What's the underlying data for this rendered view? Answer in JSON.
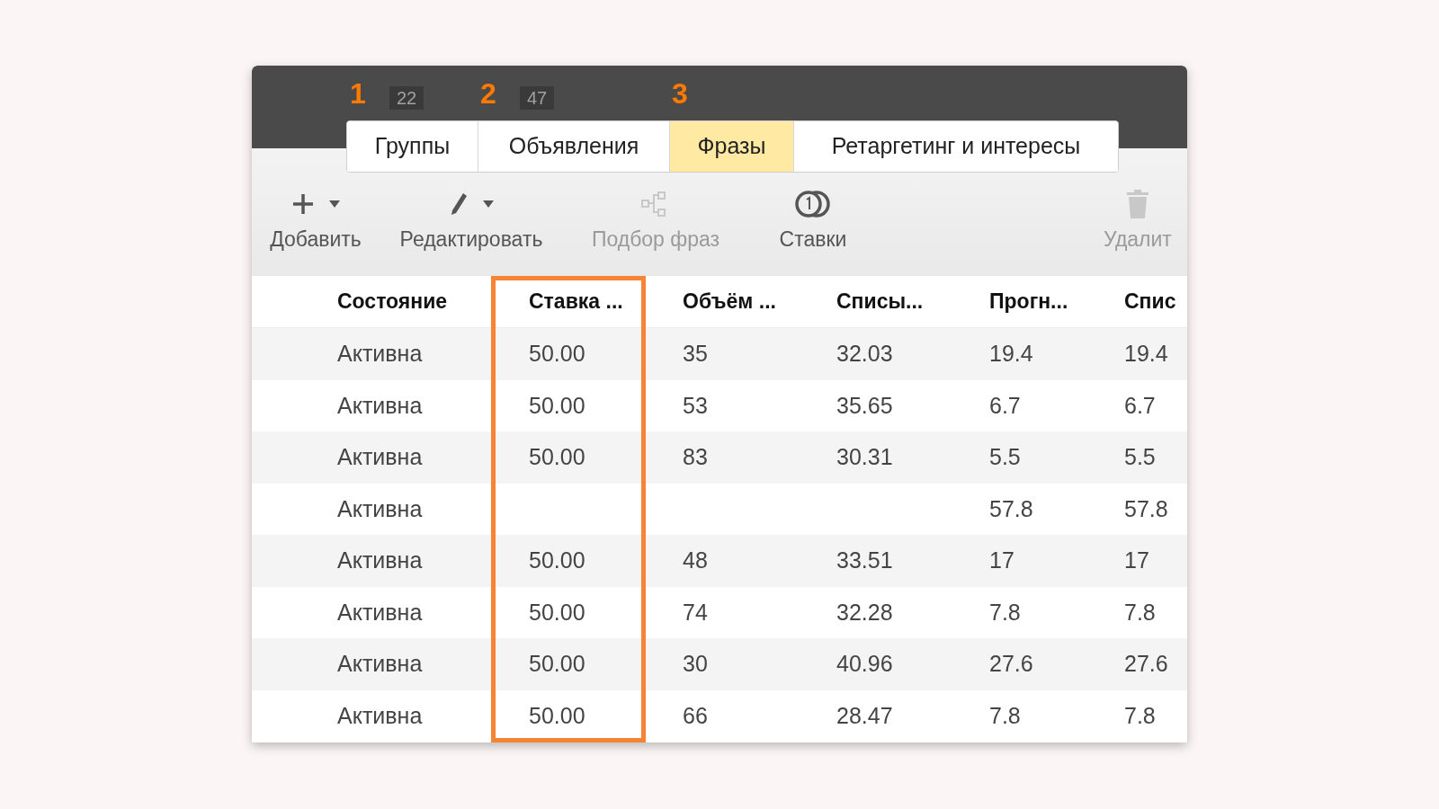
{
  "tabs": [
    {
      "label": "Группы",
      "selected": false,
      "marker": "1",
      "count": "22"
    },
    {
      "label": "Объявления",
      "selected": false,
      "marker": "2",
      "count": "47"
    },
    {
      "label": "Фразы",
      "selected": true,
      "marker": "3"
    },
    {
      "label": "Ретаргетинг и интересы",
      "selected": false
    }
  ],
  "toolbar": [
    {
      "kind": "add",
      "label": "Добавить",
      "disabled": false,
      "dropdown": true
    },
    {
      "kind": "edit",
      "label": "Редактировать",
      "disabled": false,
      "dropdown": true
    },
    {
      "kind": "phrases",
      "label": "Подбор фраз",
      "disabled": true,
      "dropdown": false
    },
    {
      "kind": "bids",
      "label": "Ставки",
      "disabled": false,
      "dropdown": false
    },
    {
      "kind": "delete",
      "label": "Удалит",
      "disabled": true,
      "dropdown": false
    }
  ],
  "table": {
    "columns": [
      {
        "label": "Состояние",
        "highlighted": false
      },
      {
        "label": "Ставка ...",
        "highlighted": true
      },
      {
        "label": "Объём ...",
        "highlighted": false
      },
      {
        "label": "Списы...",
        "highlighted": false
      },
      {
        "label": "Прогн...",
        "highlighted": false
      },
      {
        "label": "Спис",
        "highlighted": false
      }
    ],
    "rows": [
      [
        "Активна",
        "50.00",
        "35",
        "32.03",
        "19.4",
        "19.4"
      ],
      [
        "Активна",
        "50.00",
        "53",
        "35.65",
        "6.7",
        "6.7"
      ],
      [
        "Активна",
        "50.00",
        "83",
        "30.31",
        "5.5",
        "5.5"
      ],
      [
        "Активна",
        null,
        null,
        null,
        "57.8",
        "57.8"
      ],
      [
        "Активна",
        "50.00",
        "48",
        "33.51",
        "17",
        "17"
      ],
      [
        "Активна",
        "50.00",
        "74",
        "32.28",
        "7.8",
        "7.8"
      ],
      [
        "Активна",
        "50.00",
        "30",
        "40.96",
        "27.6",
        "27.6"
      ],
      [
        "Активна",
        "50.00",
        "66",
        "28.47",
        "7.8",
        "7.8"
      ]
    ]
  }
}
